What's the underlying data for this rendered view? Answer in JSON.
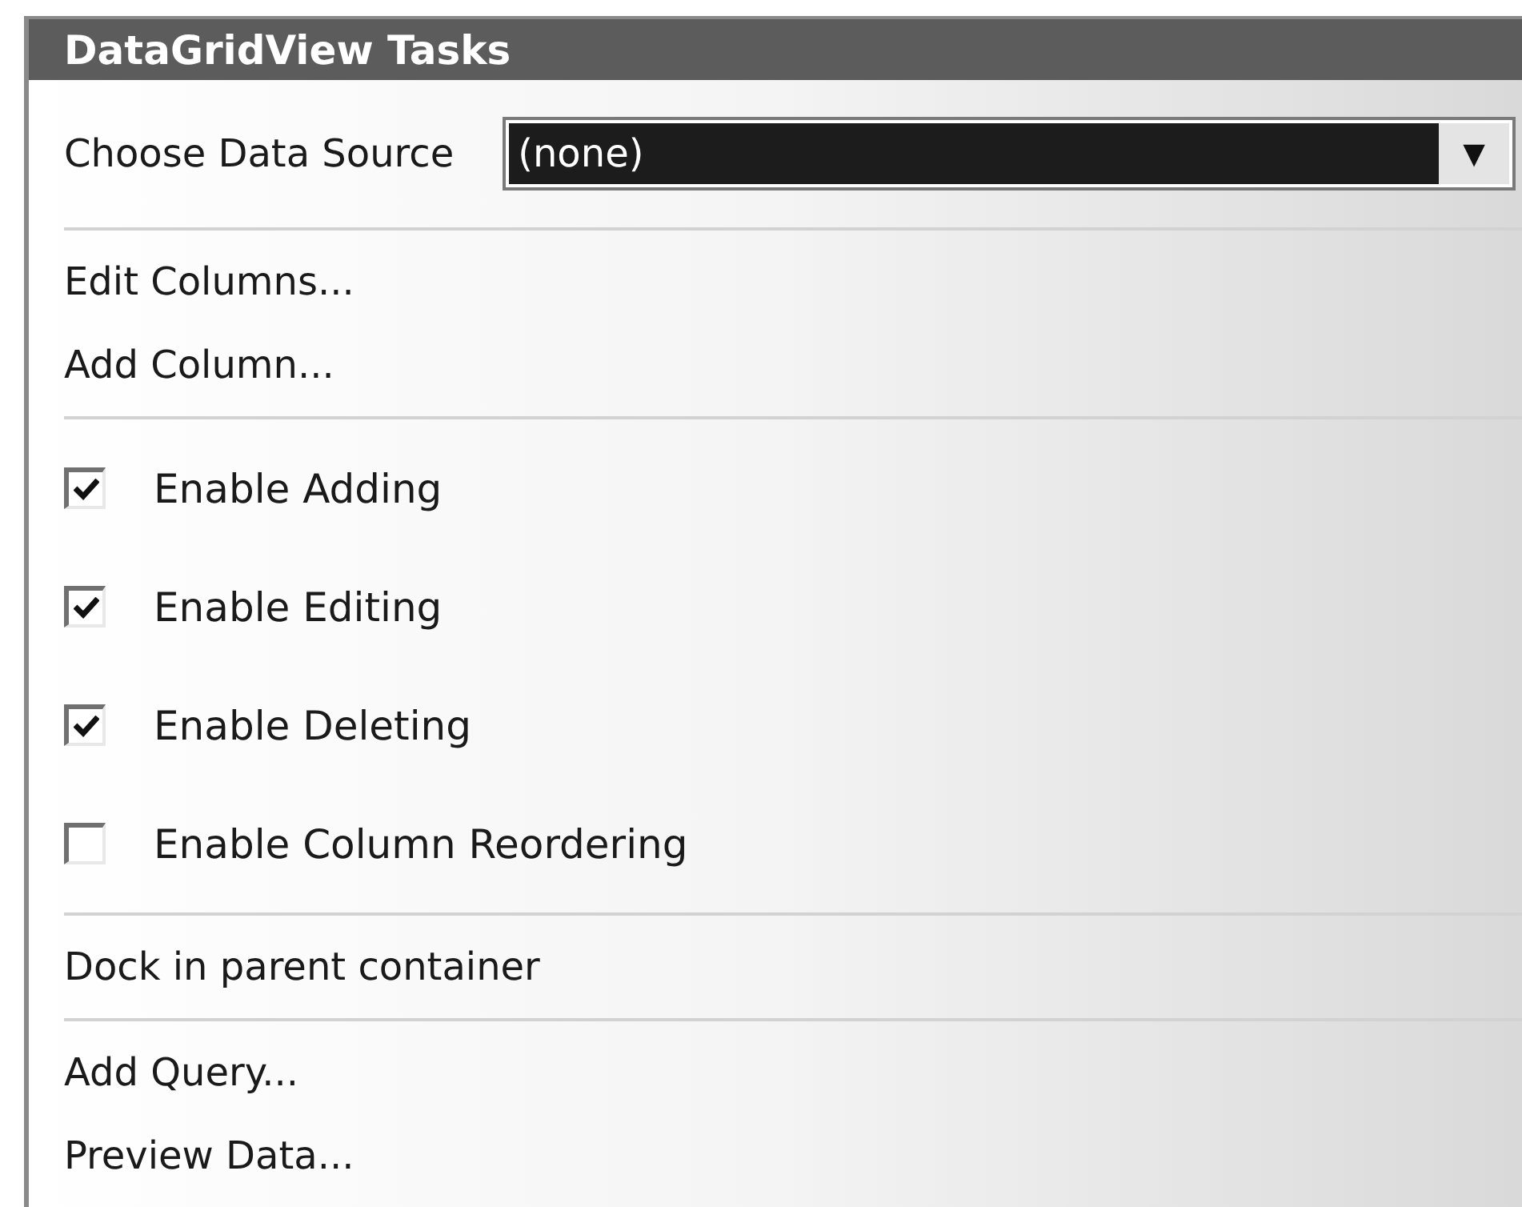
{
  "panel": {
    "title": "DataGridView Tasks"
  },
  "sections": [
    {
      "items": [
        {
          "kind": "combo",
          "label": "Choose Data Source",
          "value": "(none)",
          "arrow": "▼"
        }
      ]
    },
    {
      "items": [
        {
          "kind": "link",
          "label": "Edit Columns..."
        },
        {
          "kind": "link",
          "label": "Add Column..."
        }
      ]
    },
    {
      "items": [
        {
          "kind": "checkbox",
          "label": "Enable Adding",
          "checked": true
        },
        {
          "kind": "checkbox",
          "label": "Enable Editing",
          "checked": true
        },
        {
          "kind": "checkbox",
          "label": "Enable Deleting",
          "checked": true
        },
        {
          "kind": "checkbox",
          "label": "Enable Column Reordering",
          "checked": false
        }
      ]
    },
    {
      "items": [
        {
          "kind": "link",
          "label": "Dock in parent container"
        }
      ]
    },
    {
      "items": [
        {
          "kind": "link",
          "label": "Add Query..."
        },
        {
          "kind": "link",
          "label": "Preview Data..."
        }
      ]
    }
  ]
}
